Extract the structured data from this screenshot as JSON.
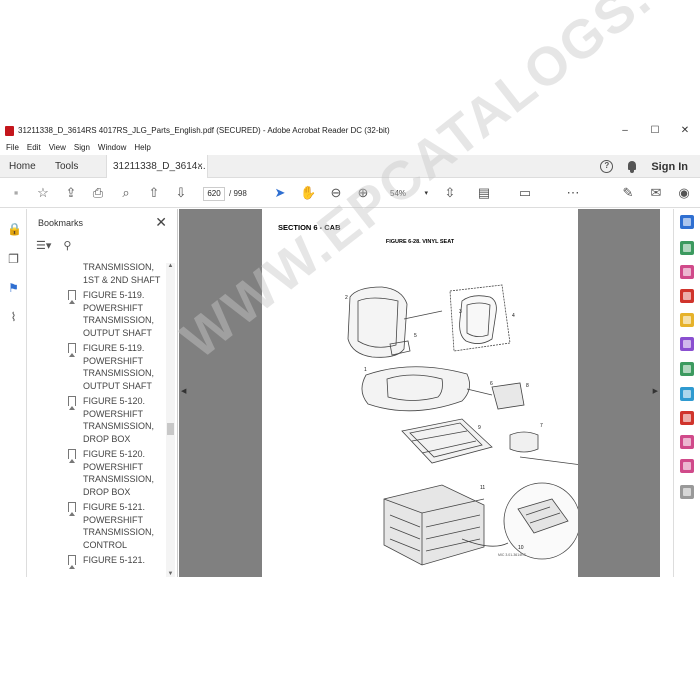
{
  "window": {
    "title": "31211338_D_3614RS 4017RS_JLG_Parts_English.pdf (SECURED) - Adobe Acrobat Reader DC (32-bit)",
    "controls": [
      "–",
      "☐",
      "✕"
    ]
  },
  "menu": [
    "File",
    "Edit",
    "View",
    "Sign",
    "Window",
    "Help"
  ],
  "tabs": {
    "home": "Home",
    "tools": "Tools",
    "document": "31211338_D_3614...",
    "close": "×",
    "sign_in": "Sign In"
  },
  "toolbar": {
    "page_current": "620",
    "page_total": "/ 998",
    "zoom": "54%"
  },
  "bookmarks": {
    "title": "Bookmarks",
    "close": "✕",
    "partial_top": [
      "TRANSMISSION,",
      "1ST & 2ND SHAFT"
    ],
    "items": [
      {
        "lines": [
          "FIGURE 5-119.",
          "POWERSHIFT",
          "TRANSMISSION,",
          "OUTPUT SHAFT"
        ]
      },
      {
        "lines": [
          "FIGURE 5-119.",
          "POWERSHIFT",
          "TRANSMISSION,",
          "OUTPUT SHAFT"
        ]
      },
      {
        "lines": [
          "FIGURE 5-120.",
          "POWERSHIFT",
          "TRANSMISSION,",
          "DROP BOX"
        ]
      },
      {
        "lines": [
          "FIGURE 5-120.",
          "POWERSHIFT",
          "TRANSMISSION,",
          "DROP BOX"
        ]
      },
      {
        "lines": [
          "FIGURE 5-121.",
          "POWERSHIFT",
          "TRANSMISSION,",
          "CONTROL"
        ]
      },
      {
        "lines": [
          "FIGURE 5-121."
        ]
      }
    ]
  },
  "page": {
    "section": "SECTION 6 - CAB",
    "figure": "FIGURE 6-28. VINYL SEAT",
    "figure_code": "MIC 3.01-3614RS",
    "callouts": [
      "1",
      "2",
      "3",
      "4",
      "5",
      "6",
      "7",
      "8",
      "9",
      "10",
      "11"
    ],
    "watermark": "WWW.EPCATALOGS.COM"
  },
  "colors": {
    "doc_background": "#808080",
    "accent_blue": "#2f6fd1",
    "app_red": "#c4161c"
  }
}
